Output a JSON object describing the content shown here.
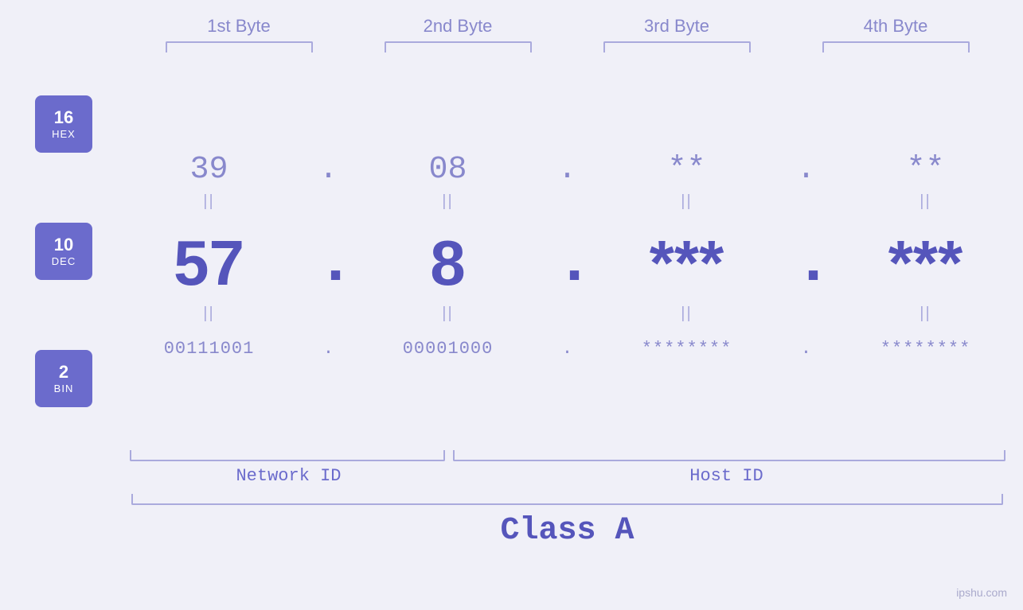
{
  "headers": {
    "byte1": "1st Byte",
    "byte2": "2nd Byte",
    "byte3": "3rd Byte",
    "byte4": "4th Byte"
  },
  "badges": {
    "hex": {
      "num": "16",
      "label": "HEX"
    },
    "dec": {
      "num": "10",
      "label": "DEC"
    },
    "bin": {
      "num": "2",
      "label": "BIN"
    }
  },
  "hex_row": {
    "b1": "39",
    "b2": "08",
    "b3": "**",
    "b4": "**",
    "dots": [
      ".",
      ".",
      "."
    ]
  },
  "dec_row": {
    "b1": "57",
    "b2": "8",
    "b3": "***",
    "b4": "***",
    "dots": [
      ".",
      ".",
      "."
    ]
  },
  "bin_row": {
    "b1": "00111001",
    "b2": "00001000",
    "b3": "********",
    "b4": "********",
    "dots": [
      ".",
      ".",
      "."
    ]
  },
  "labels": {
    "network_id": "Network ID",
    "host_id": "Host ID",
    "class": "Class A"
  },
  "watermark": "ipshu.com",
  "eq_sign": "||"
}
